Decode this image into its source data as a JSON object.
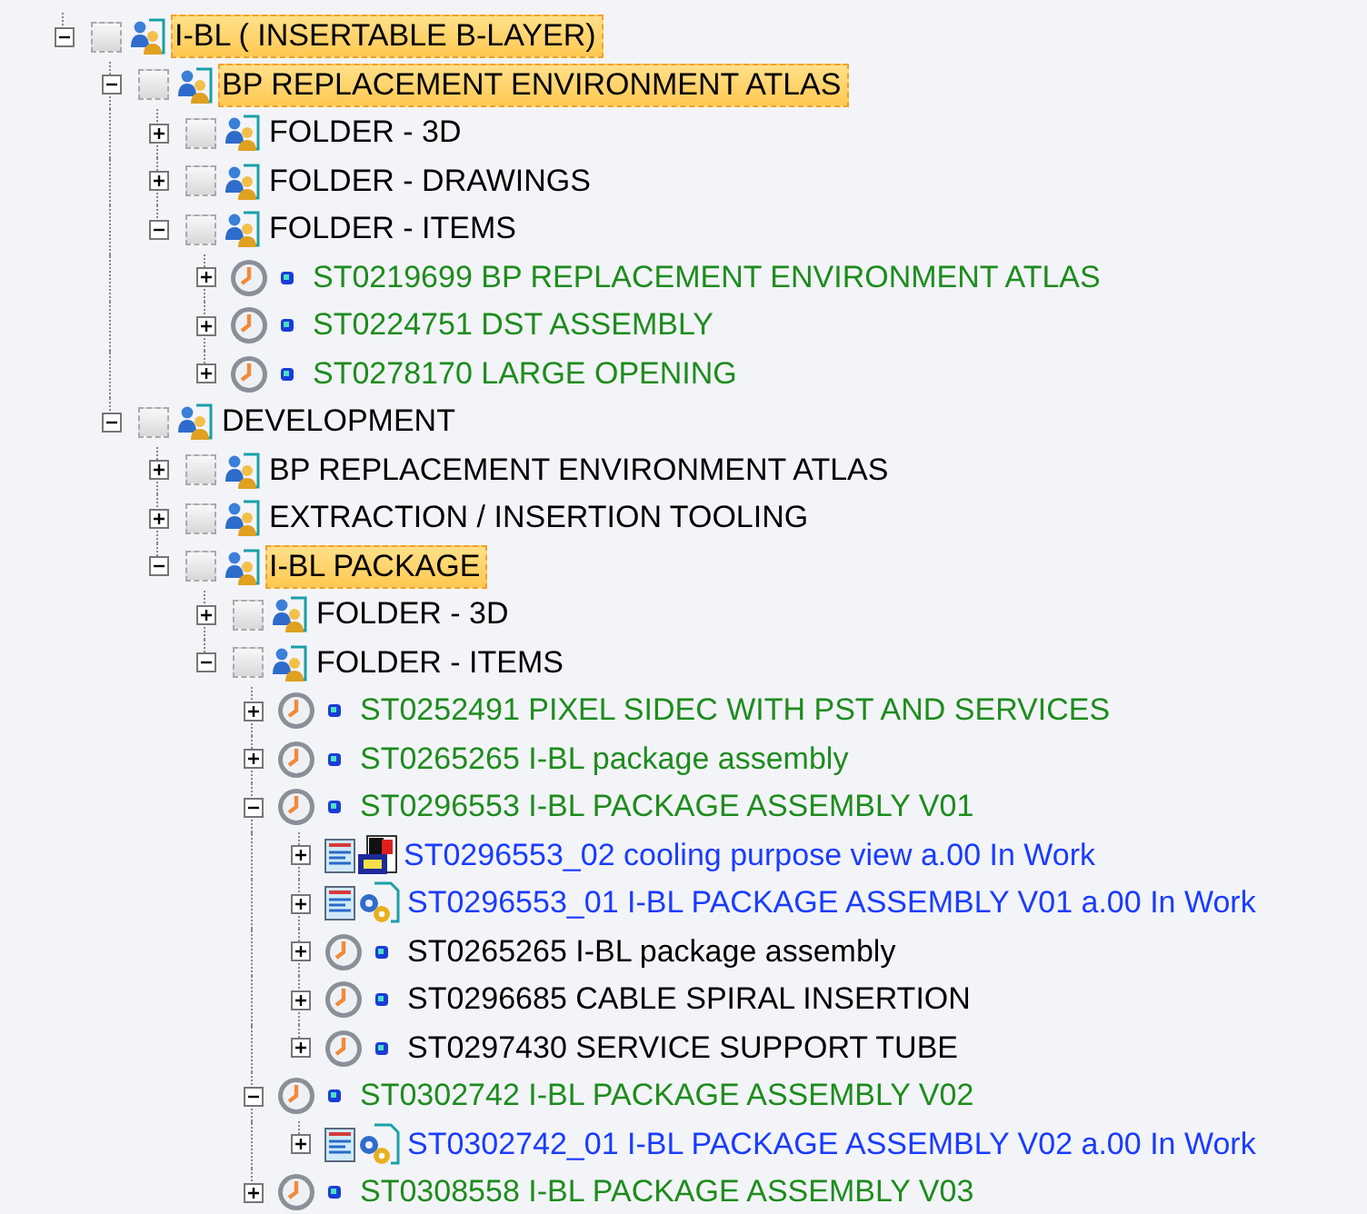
{
  "tree": [
    {
      "kind": "folder",
      "label": "I-BL ( INSERTABLE B-LAYER)",
      "expanded": true,
      "selected": true,
      "checked": false,
      "color": "#000000",
      "children": [
        {
          "kind": "folder",
          "label": "BP REPLACEMENT ENVIRONMENT ATLAS",
          "expanded": true,
          "selected": true,
          "checked": false,
          "color": "#000000",
          "children": [
            {
              "kind": "folder",
              "label": "FOLDER - 3D",
              "expanded": false,
              "selected": false,
              "checked": false,
              "color": "#000000"
            },
            {
              "kind": "folder",
              "label": "FOLDER - DRAWINGS",
              "expanded": false,
              "selected": false,
              "checked": false,
              "color": "#000000"
            },
            {
              "kind": "folder",
              "label": "FOLDER - ITEMS",
              "expanded": true,
              "selected": false,
              "checked": false,
              "color": "#000000",
              "children": [
                {
                  "kind": "item",
                  "label": "ST0219699 BP REPLACEMENT ENVIRONMENT ATLAS",
                  "expanded": false,
                  "selected": false,
                  "color": "#1e8c1e"
                },
                {
                  "kind": "item",
                  "label": "ST0224751 DST ASSEMBLY",
                  "expanded": false,
                  "selected": false,
                  "color": "#1e8c1e"
                },
                {
                  "kind": "item",
                  "label": "ST0278170 LARGE OPENING",
                  "expanded": false,
                  "selected": false,
                  "color": "#1e8c1e"
                }
              ]
            }
          ]
        },
        {
          "kind": "folder",
          "label": "DEVELOPMENT",
          "expanded": true,
          "selected": false,
          "checked": false,
          "color": "#000000",
          "children": [
            {
              "kind": "folder",
              "label": "BP REPLACEMENT ENVIRONMENT ATLAS",
              "expanded": false,
              "selected": false,
              "checked": false,
              "color": "#000000"
            },
            {
              "kind": "folder",
              "label": "EXTRACTION / INSERTION TOOLING",
              "expanded": false,
              "selected": false,
              "checked": false,
              "color": "#000000"
            },
            {
              "kind": "folder",
              "label": "I-BL PACKAGE",
              "expanded": true,
              "selected": true,
              "checked": false,
              "color": "#000000",
              "children": [
                {
                  "kind": "folder",
                  "label": "FOLDER - 3D",
                  "expanded": false,
                  "selected": false,
                  "checked": false,
                  "color": "#000000"
                },
                {
                  "kind": "folder",
                  "label": "FOLDER - ITEMS",
                  "expanded": true,
                  "selected": false,
                  "checked": false,
                  "color": "#000000",
                  "children": [
                    {
                      "kind": "item",
                      "label": "ST0252491 PIXEL SIDEC WITH PST AND SERVICES",
                      "expanded": false,
                      "selected": false,
                      "color": "#1e8c1e"
                    },
                    {
                      "kind": "item",
                      "label": "ST0265265 I-BL package assembly",
                      "expanded": false,
                      "selected": false,
                      "color": "#1e8c1e"
                    },
                    {
                      "kind": "item",
                      "label": "ST0296553 I-BL PACKAGE ASSEMBLY V01",
                      "expanded": true,
                      "selected": false,
                      "color": "#1e8c1e",
                      "children": [
                        {
                          "kind": "snapshot",
                          "label": "ST0296553_02 cooling purpose view a.00 In Work",
                          "expanded": false,
                          "selected": false,
                          "color": "#1a3cff"
                        },
                        {
                          "kind": "model",
                          "label": "ST0296553_01 I-BL PACKAGE ASSEMBLY V01 a.00 In Work",
                          "expanded": false,
                          "selected": false,
                          "color": "#1a3cff"
                        },
                        {
                          "kind": "item",
                          "label": "ST0265265 I-BL package assembly",
                          "expanded": false,
                          "selected": false,
                          "color": "#000000"
                        },
                        {
                          "kind": "item",
                          "label": "ST0296685 CABLE SPIRAL INSERTION",
                          "expanded": false,
                          "selected": false,
                          "color": "#000000"
                        },
                        {
                          "kind": "item",
                          "label": "ST0297430 SERVICE SUPPORT TUBE",
                          "expanded": false,
                          "selected": false,
                          "color": "#000000"
                        }
                      ]
                    },
                    {
                      "kind": "item",
                      "label": "ST0302742 I-BL PACKAGE ASSEMBLY V02",
                      "expanded": true,
                      "selected": false,
                      "color": "#1e8c1e",
                      "children": [
                        {
                          "kind": "model",
                          "label": "ST0302742_01 I-BL PACKAGE ASSEMBLY V02 a.00 In Work",
                          "expanded": false,
                          "selected": false,
                          "color": "#1a3cff"
                        }
                      ]
                    },
                    {
                      "kind": "item",
                      "label": "ST0308558 I-BL PACKAGE ASSEMBLY V03",
                      "expanded": false,
                      "selected": false,
                      "color": "#1e8c1e"
                    }
                  ]
                }
              ]
            }
          ]
        }
      ]
    }
  ]
}
